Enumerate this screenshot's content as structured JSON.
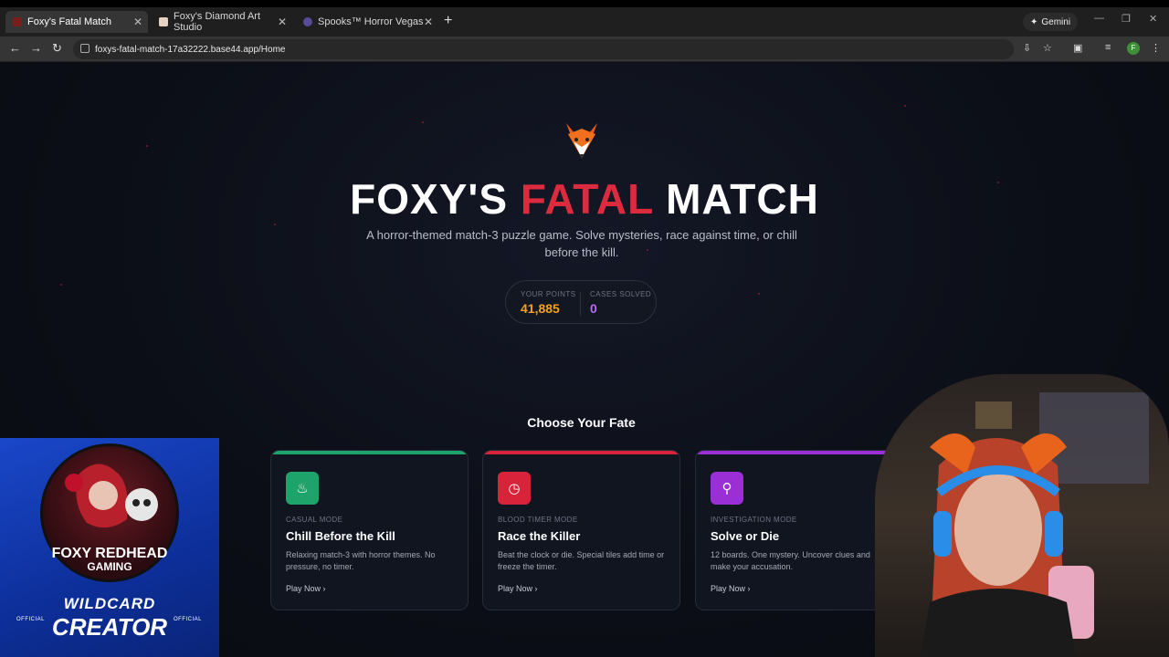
{
  "browser": {
    "tabs": [
      {
        "label": "Foxy's Fatal Match",
        "active": true
      },
      {
        "label": "Foxy's Diamond Art Studio",
        "active": false
      },
      {
        "label": "Spooks™ Horror Vegas",
        "active": false
      }
    ],
    "gemini_label": "Gemini",
    "url": "foxys-fatal-match-17a32222.base44.app/Home",
    "profile_initial": "F"
  },
  "hero": {
    "title_part1": "FOXY'S",
    "title_part2": "FATAL",
    "title_part3": "MATCH",
    "subtitle": "A horror-themed match-3 puzzle game. Solve mysteries, race against time, or chill before the kill."
  },
  "stats": {
    "points_label": "YOUR POINTS",
    "points_value": "41,885",
    "cases_label": "CASES SOLVED",
    "cases_value": "0"
  },
  "section_title": "Choose Your Fate",
  "cards": [
    {
      "mode": "CASUAL MODE",
      "title": "Chill Before the Kill",
      "desc": "Relaxing match-3 with horror themes. No pressure, no timer.",
      "cta": "Play Now",
      "color": "#1ea46a",
      "icon": "flame-icon"
    },
    {
      "mode": "BLOOD TIMER MODE",
      "title": "Race the Killer",
      "desc": "Beat the clock or die. Special tiles add time or freeze the timer.",
      "cta": "Play Now",
      "color": "#d8243a",
      "icon": "clock-icon"
    },
    {
      "mode": "INVESTIGATION MODE",
      "title": "Solve or Die",
      "desc": "12 boards. One mystery. Uncover clues and make your accusation.",
      "cta": "Play Now",
      "color": "#9b2fd6",
      "icon": "search-icon"
    }
  ],
  "overlay": {
    "line1": "FOXY REDHEAD",
    "line2": "GAMING",
    "wild": "WILDCARD",
    "creator": "CREATOR",
    "official": "OFFICIAL"
  },
  "colors": {
    "points": "#f3a21b",
    "cases": "#b66cf2",
    "accent_red": "#dc2a3e"
  }
}
